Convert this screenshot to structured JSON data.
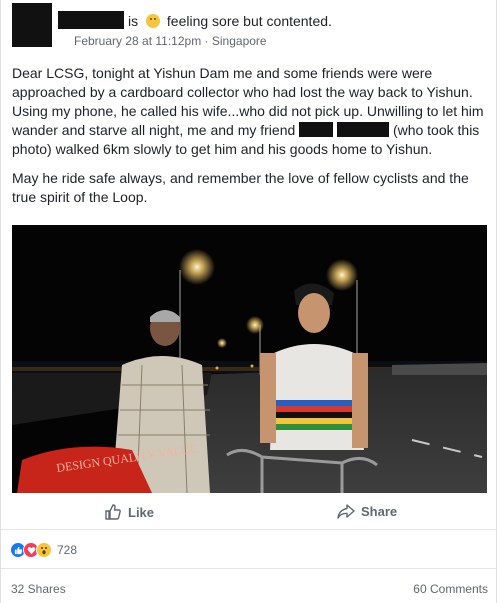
{
  "post": {
    "author_redacted": true,
    "status_prefix": "is",
    "feeling_icon": "slightly-smiling-emoji",
    "status_text": "feeling sore but contented.",
    "date": "February 28 at 11:12pm",
    "separator": "·",
    "location": "Singapore",
    "paragraph_1_part_a": "Dear LCSG, tonight at Yishun Dam me and some friends were were approached by a cardboard collector who had lost the way back to Yishun. Using my phone, he called his wife...who did not pick up. Unwilling to let him wander and starve all night, me and my friend",
    "paragraph_1_part_b": "(who took this photo) walked 6km slowly to get him and his goods home to Yishun.",
    "paragraph_2": "May he ride safe always, and remember the love of fellow cyclists and the true spirit of the Loop."
  },
  "photo": {
    "bag_text": "DESIGN QUALITY VALUE"
  },
  "actions": {
    "like_label": "Like",
    "share_label": "Share"
  },
  "reactions": {
    "types": [
      "like",
      "love",
      "wow"
    ],
    "count": "728"
  },
  "footer": {
    "shares": "32 Shares",
    "comments": "60 Comments"
  },
  "colors": {
    "text": "#1d2129",
    "meta": "#616770",
    "like_blue": "#1877f2",
    "love_red": "#f33e58",
    "wow_yellow": "#f7c53b"
  }
}
